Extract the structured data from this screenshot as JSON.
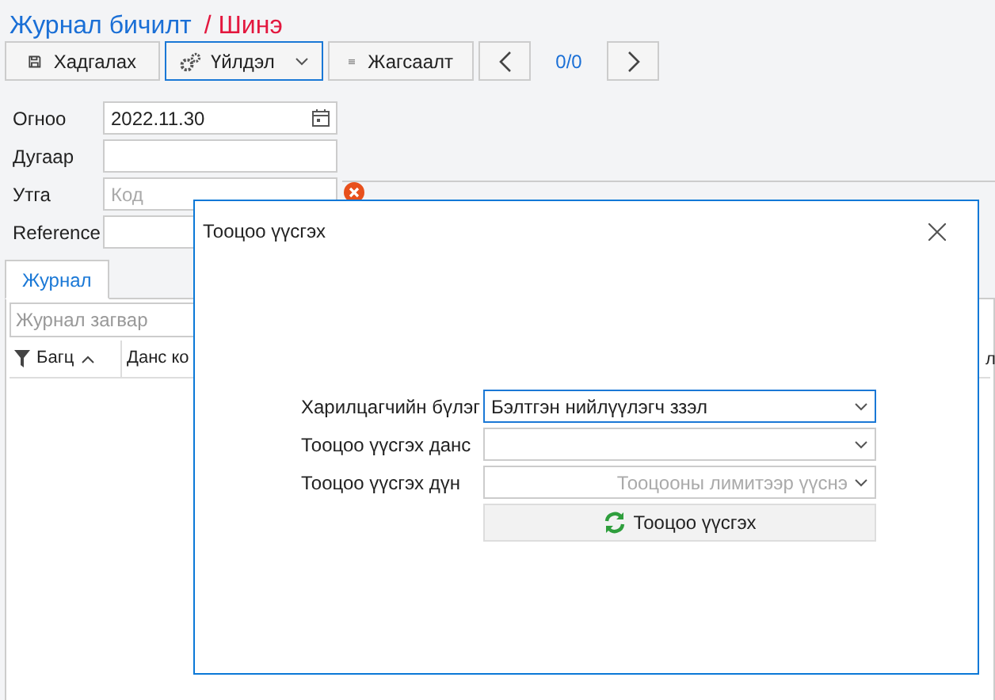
{
  "header": {
    "title": "Журнал бичилт",
    "subtitle": "/ Шинэ"
  },
  "toolbar": {
    "save": "Хадгалах",
    "actions": "Үйлдэл",
    "list": "Жагсаалт",
    "pager": "0/0"
  },
  "form": [
    {
      "label": "Огноо",
      "value": "2022.11.30",
      "kind": "date"
    },
    {
      "label": "Дугаар",
      "kind": "text"
    },
    {
      "label": "Утга",
      "placeholder": "Код",
      "kind": "combo"
    },
    {
      "label": "Reference",
      "kind": "text"
    }
  ],
  "tabs": [
    {
      "label": "Журнал",
      "selected": true
    }
  ],
  "journal_template": {
    "placeholder": "Журнал загвар"
  },
  "grid": {
    "columns": [
      "Багц",
      "Данс ко",
      "л"
    ]
  },
  "dialog": {
    "title": "Тооцоо үүсгэх",
    "fields": [
      {
        "label": "Харилцагчийн бүлэг",
        "value": "Бэлтгэн нийлүүлэгч ззэл",
        "focused": true
      },
      {
        "label": "Тооцоо үүсгэх данс",
        "focused": false
      },
      {
        "label": "Тооцоо үүсгэх дүн",
        "placeholder": "Тооцооны лимитээр үүснэ",
        "focused": false
      }
    ],
    "button": "Тооцоо үүсгэх"
  }
}
